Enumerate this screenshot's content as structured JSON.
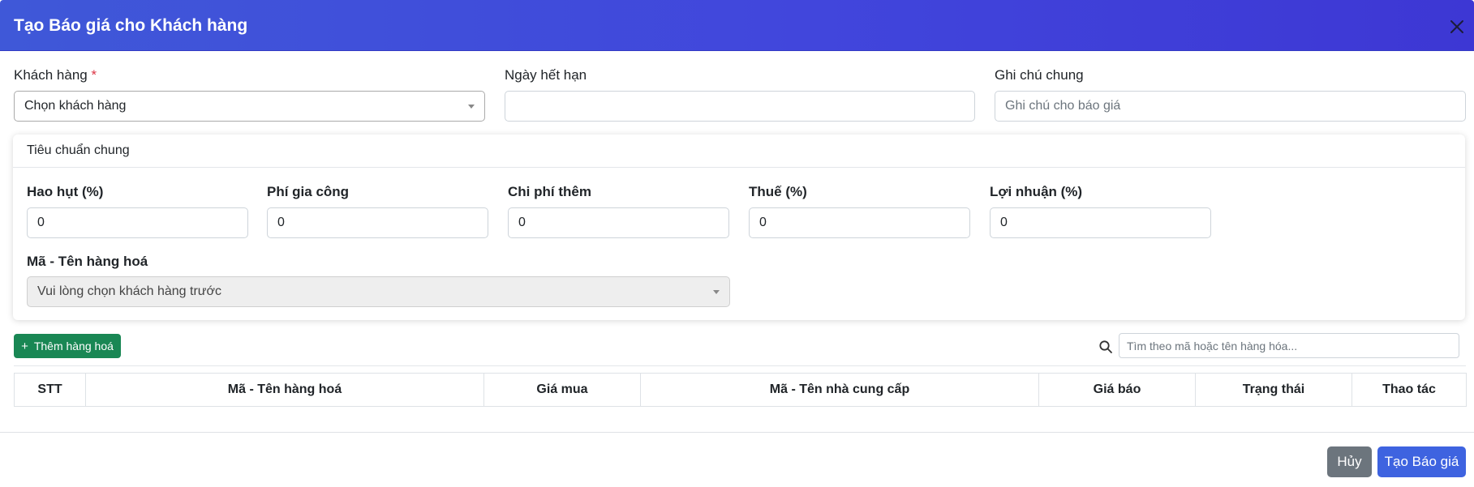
{
  "modal": {
    "title": "Tạo Báo giá cho Khách hàng"
  },
  "form": {
    "customer": {
      "label": "Khách hàng",
      "required_mark": "*",
      "selected": "Chọn khách hàng"
    },
    "expiry": {
      "label": "Ngày hết hạn",
      "value": ""
    },
    "note": {
      "label": "Ghi chú chung",
      "placeholder": "Ghi chú cho báo giá"
    }
  },
  "standards": {
    "title": "Tiêu chuẩn chung",
    "fields": [
      {
        "label": "Hao hụt (%)",
        "value": "0"
      },
      {
        "label": "Phí gia công",
        "value": "0"
      },
      {
        "label": "Chi phí thêm",
        "value": "0"
      },
      {
        "label": "Thuế (%)",
        "value": "0"
      },
      {
        "label": "Lợi nhuận (%)",
        "value": "0"
      }
    ],
    "product": {
      "label": "Mã - Tên hàng hoá",
      "selected": "Vui lòng chọn khách hàng trước"
    }
  },
  "toolbar": {
    "add_label": "Thêm hàng hoá",
    "search_placeholder": "Tìm theo mã hoặc tên hàng hóa..."
  },
  "table": {
    "columns": [
      "STT",
      "Mã - Tên hàng hoá",
      "Giá mua",
      "Mã - Tên nhà cung cấp",
      "Giá báo",
      "Trạng thái",
      "Thao tác"
    ]
  },
  "footer": {
    "cancel_label": "Hủy",
    "create_label": "Tạo Báo giá"
  },
  "colors": {
    "header_gradient_start": "#3f58d8",
    "header_gradient_end": "#3d37d4",
    "add_button": "#198754",
    "cancel_button": "#6c757d",
    "create_button": "#3e63e0",
    "required": "#dc3545"
  },
  "icons": {
    "close": "close-icon",
    "search": "search-icon",
    "caret": "chevron-down-icon"
  }
}
